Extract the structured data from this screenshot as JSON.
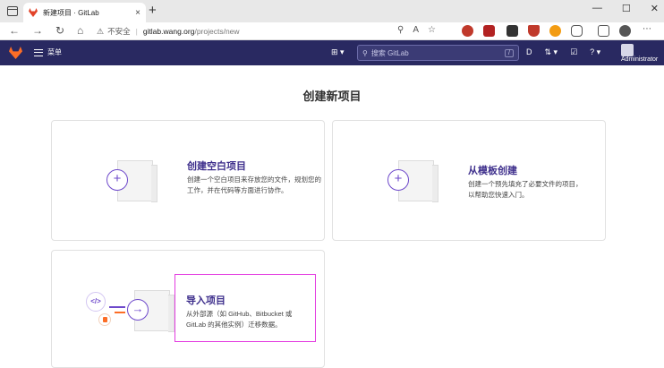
{
  "browser": {
    "tab_title": "新建项目 · GitLab",
    "tab_close": "×",
    "new_tab": "+",
    "window_controls": [
      "—",
      "☐",
      "✕"
    ],
    "nav_icons": [
      "←",
      "→",
      "↻",
      "⌂"
    ],
    "insecure_label": "不安全",
    "url_host": "gitlab.wang.org",
    "url_path": "/projects/new",
    "addr_icons": [
      "⚲",
      "A",
      "☆"
    ]
  },
  "gitlab_nav": {
    "menu_label": "菜单",
    "search_placeholder": "搜索 GitLab",
    "search_shortcut": "/",
    "new_button": "⊞ ▾",
    "icons": [
      "D",
      "⇅ ▾",
      "☑",
      "? ▾"
    ],
    "user_label": "Administrator"
  },
  "page": {
    "title": "创建新项目",
    "cards": [
      {
        "title": "创建空白项目",
        "description": "创建一个空白项目来存放您的文件，规划您的工作，并在代码等方面进行协作。",
        "icon": "+"
      },
      {
        "title": "从模板创建",
        "description": "创建一个预先填充了必要文件的项目，以帮助您快速入门。",
        "icon": "+"
      },
      {
        "title": "导入项目",
        "description": "从外部源（如 GitHub、Bitbucket 或 GitLab 的其他实例）迁移数据。",
        "icon": "→",
        "code_icon": "</>"
      }
    ]
  },
  "colors": {
    "navbar": "#292961",
    "accent": "#6e49cb",
    "title": "#3e2f8c",
    "highlight": "#e33be0",
    "gitlab_orange": "#fc6d26"
  }
}
